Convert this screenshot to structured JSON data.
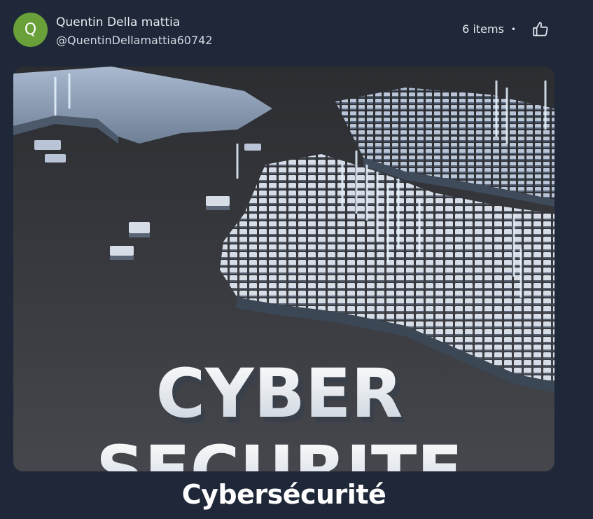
{
  "author": {
    "avatar_letter": "Q",
    "avatar_color": "#69a03a",
    "name": "Quentin Della mattia",
    "handle": "@QuentinDellamattia60742"
  },
  "meta": {
    "item_count": "6 items",
    "separator": "•",
    "like_icon": "thumbs-up-icon"
  },
  "thumbnail": {
    "overlay_text_line1": "CYBER",
    "overlay_text_line2": "SECURITE"
  },
  "post": {
    "title": "Cybersécurité"
  },
  "colors": {
    "background": "#1f2838",
    "text": "#e6e9ef"
  }
}
